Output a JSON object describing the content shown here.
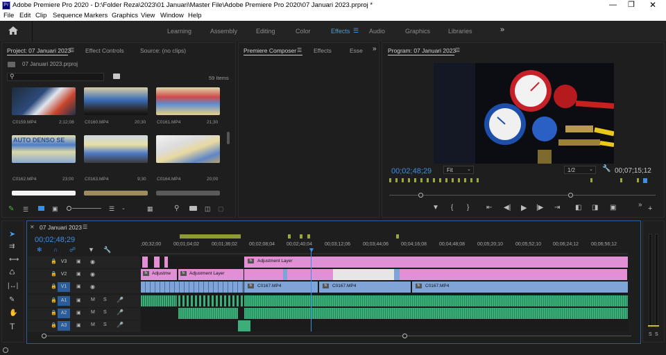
{
  "window": {
    "title": "Adobe Premiere Pro 2020 - D:\\Folder Reza\\2023\\01 Januari\\Master File\\Adobe Premiere Pro 2020\\07 Januari 2023.prproj *",
    "app_icon": "Pr"
  },
  "menu": [
    "File",
    "Edit",
    "Clip",
    "Sequence",
    "Markers",
    "Graphics",
    "View",
    "Window",
    "Help"
  ],
  "workspaces": {
    "tabs": [
      "Learning",
      "Assembly",
      "Editing",
      "Color",
      "Effects",
      "Audio",
      "Graphics",
      "Libraries"
    ],
    "active": "Effects",
    "more": "»"
  },
  "project_panel": {
    "tabs": [
      "Project: 07 Januari 2023",
      "Effect Controls",
      "Source: (no clips)"
    ],
    "file": "07 Januari 2023.prproj",
    "items_count": "59 Items",
    "clips": [
      {
        "name": "C0159.MP4",
        "duration": "2;12;08"
      },
      {
        "name": "C0160.MP4",
        "duration": "20;30"
      },
      {
        "name": "C0161.MP4",
        "duration": "21;30"
      },
      {
        "name": "C0162.MP4",
        "duration": "23;00"
      },
      {
        "name": "C0163.MP4",
        "duration": "9;30"
      },
      {
        "name": "C0164.MP4",
        "duration": "20;00"
      }
    ]
  },
  "composer_panel": {
    "tabs": [
      "Premiere Composer",
      "Effects",
      "Esse"
    ]
  },
  "program_monitor": {
    "title": "Program: 07 Januari 2023",
    "timecode": "00;02;48;29",
    "fit": "Fit",
    "resolution": "1/2",
    "duration": "00;07;15;12"
  },
  "timeline": {
    "sequence_name": "07 Januari 2023",
    "timecode": "00;02;48;29",
    "ruler": [
      ";00;32;00",
      "00;01;04;02",
      "00;01;36;02",
      "00;02;08;04",
      "00;02;40;04",
      "00;03;12;06",
      "00;03;44;06",
      "00;04;16;08",
      "00;04;48;08",
      "00;05;20;10",
      "00;05;52;10",
      "00;06;24;12",
      "00;06;56;12"
    ],
    "tracks": [
      {
        "name": "V3",
        "toggle": ""
      },
      {
        "name": "V2",
        "toggle": ""
      },
      {
        "name": "V1",
        "toggle": ""
      },
      {
        "name": "A1",
        "toggle": "M"
      },
      {
        "name": "A2",
        "toggle": "M"
      },
      {
        "name": "A3",
        "toggle": "M"
      }
    ],
    "clip_labels": {
      "adj_v3": "Adjustment Layer",
      "adj_v2_a": "Adjustme",
      "adj_v2_b": "Adjustment Layer",
      "v1_a": "C0167.MP4",
      "v1_b": "C0167.MP4",
      "v1_c": "C0167.MP4"
    },
    "solo": "S"
  },
  "audio_meter": {
    "solo_labels": [
      "S",
      "S"
    ]
  }
}
